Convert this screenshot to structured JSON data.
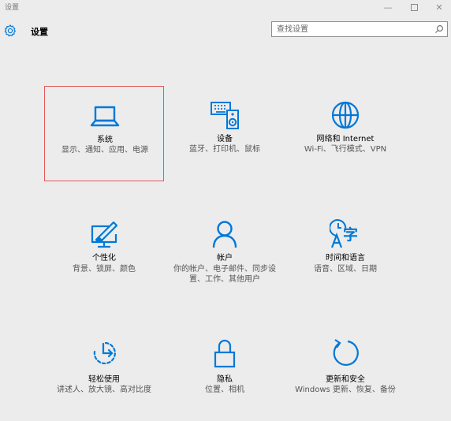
{
  "window": {
    "title": "设置",
    "min_glyph": "—",
    "close_glyph": "✕"
  },
  "header": {
    "title": "设置",
    "gear_icon": "gear-icon"
  },
  "search": {
    "placeholder": "查找设置",
    "icon": "search-icon"
  },
  "accent": "#0078d7",
  "selection_border": "#e35a5a",
  "tiles": [
    {
      "name": "系统",
      "desc": "显示、通知、应用、电源",
      "icon": "laptop-icon",
      "selected": true
    },
    {
      "name": "设备",
      "desc": "蓝牙、打印机、鼠标",
      "icon": "devices-icon"
    },
    {
      "name": "网络和 Internet",
      "desc": "Wi-Fi、飞行模式、VPN",
      "icon": "globe-icon"
    },
    {
      "name": "个性化",
      "desc": "背景、锁屏、颜色",
      "icon": "personalization-icon"
    },
    {
      "name": "帐户",
      "desc": "你的帐户、电子邮件、同步设置、工作、其他用户",
      "icon": "person-icon"
    },
    {
      "name": "时间和语言",
      "desc": "语音、区域、日期",
      "icon": "time-language-icon",
      "glyph": "字"
    },
    {
      "name": "轻松使用",
      "desc": "讲述人、放大镜、高对比度",
      "icon": "ease-of-access-icon"
    },
    {
      "name": "隐私",
      "desc": "位置、相机",
      "icon": "lock-icon"
    },
    {
      "name": "更新和安全",
      "desc": "Windows 更新、恢复、备份",
      "icon": "update-icon"
    }
  ]
}
